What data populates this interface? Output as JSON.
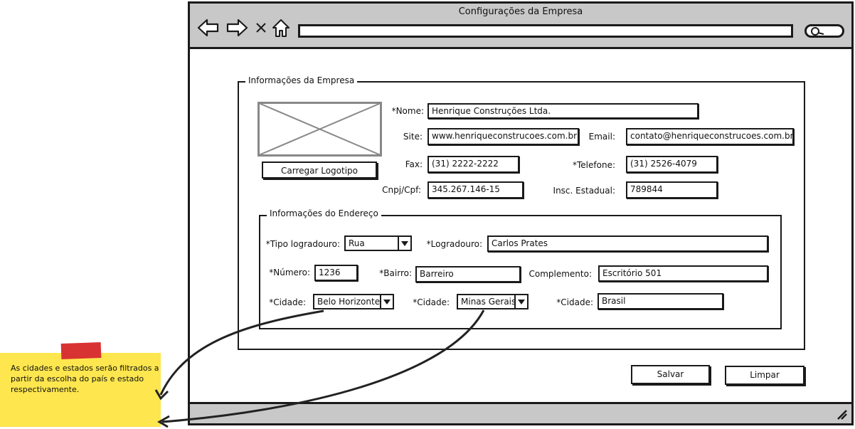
{
  "window": {
    "title": "Configurações da Empresa"
  },
  "company_section": {
    "legend": "Informações da Empresa",
    "logo_button": "Carregar Logotipo",
    "name_label": "*Nome:",
    "name_value": "Henrique Construções Ltda.",
    "site_label": "Site:",
    "site_value": "www.henriqueconstrucoes.com.br",
    "email_label": "Email:",
    "email_value": "contato@henriqueconstrucoes.com.br",
    "fax_label": "Fax:",
    "fax_value": "(31) 2222-2222",
    "phone_label": "*Telefone:",
    "phone_value": "(31) 2526-4079",
    "cnpj_label": "Cnpj/Cpf:",
    "cnpj_value": "345.267.146-15",
    "state_reg_label": "Insc. Estadual:",
    "state_reg_value": "789844"
  },
  "address_section": {
    "legend": "Informações do Endereço",
    "street_type_label": "*Tipo logradouro:",
    "street_type_value": "Rua",
    "street_label": "*Logradouro:",
    "street_value": "Carlos Prates",
    "number_label": "*Número:",
    "number_value": "1236",
    "district_label": "*Bairro:",
    "district_value": "Barreiro",
    "complement_label": "Complemento:",
    "complement_value": "Escritório 501",
    "city_label": "*Cidade:",
    "city_value": "Belo Horizonte",
    "state_label": "*Cidade:",
    "state_value": "Minas Gerais",
    "country_label": "*Cidade:",
    "country_value": "Brasil"
  },
  "actions": {
    "save": "Salvar",
    "clear": "Limpar"
  },
  "note": {
    "text": "As cidades e estados serão filtrados a partir da escolha do país e estado respectivamente."
  }
}
